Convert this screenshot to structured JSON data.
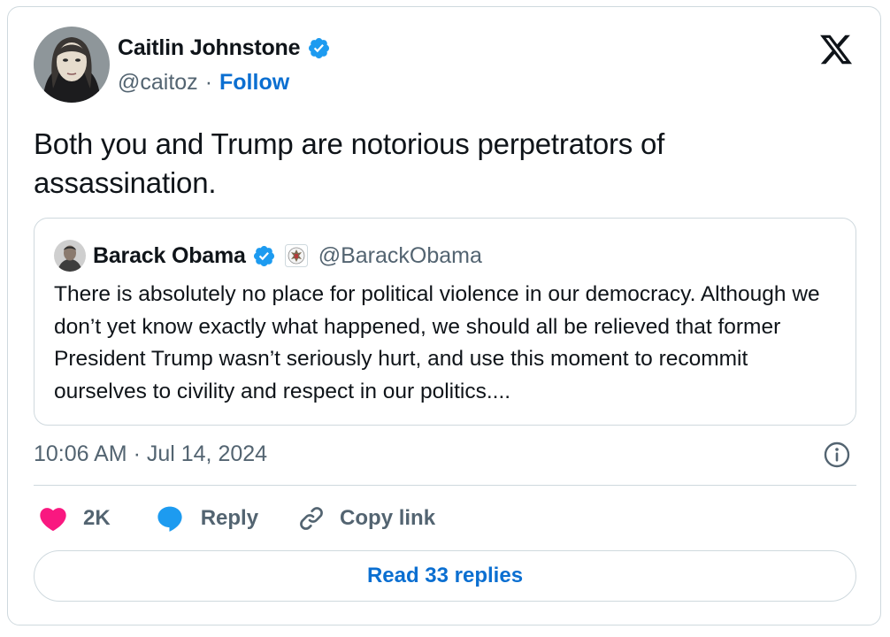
{
  "author": {
    "name": "Caitlin Johnstone",
    "handle": "@caitoz",
    "separator": "·",
    "follow_label": "Follow",
    "verified_icon": "verified-badge-icon"
  },
  "brand": {
    "logo": "x-logo"
  },
  "tweet": {
    "text": "Both you and Trump are notorious perpetrators of assassination."
  },
  "quoted": {
    "name": "Barack Obama",
    "handle": "@BarackObama",
    "affiliation_icon": "government-seal-icon",
    "text": "There is absolutely no place for political violence in our democracy. Although we don’t yet know exactly what happened, we should all be relieved that former President Trump wasn’t seriously hurt, and use this moment to recommit ourselves to civility and respect in our politics...."
  },
  "meta": {
    "timestamp": "10:06 AM · Jul 14, 2024"
  },
  "actions": {
    "like_count": "2K",
    "reply_label": "Reply",
    "copy_label": "Copy link"
  },
  "footer": {
    "read_replies_label": "Read 33 replies"
  },
  "colors": {
    "like": "#f91880",
    "reply": "#1d9bf0",
    "link": "#0b6fd1",
    "verified": "#1d9bf0",
    "secondary_text": "#536471",
    "border": "#cfd9de"
  }
}
